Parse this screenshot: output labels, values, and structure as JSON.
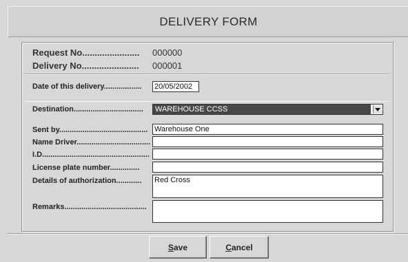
{
  "window": {
    "title": "DELIVERY FORM"
  },
  "header_info": {
    "request_label": "Request No.......................",
    "request_value": "000000",
    "delivery_label": "Delivery No.......................",
    "delivery_value": "000001"
  },
  "date": {
    "label": "Date of this delivery..................",
    "value": "20/05/2002"
  },
  "destination": {
    "label": "Destination.................................",
    "value": "WAREHOUSE CCSS"
  },
  "fields": {
    "sent_by": {
      "label": "Sent by..........................................",
      "value": "Warehouse One"
    },
    "name_driver": {
      "label": "Name Driver...................................",
      "value": ""
    },
    "id": {
      "label": "I.D...................................................",
      "value": ""
    },
    "license_plate": {
      "label": "License plate number..............",
      "value": ""
    },
    "authorization": {
      "label": "Details of authorization............",
      "value": "Red Cross"
    },
    "remarks": {
      "label": "Remarks.......................................",
      "value": ""
    }
  },
  "buttons": {
    "save_accel": "S",
    "save_rest": "ave",
    "cancel_accel": "C",
    "cancel_rest": "ancel"
  },
  "icons": {
    "dropdown": "chevron-down-icon"
  }
}
